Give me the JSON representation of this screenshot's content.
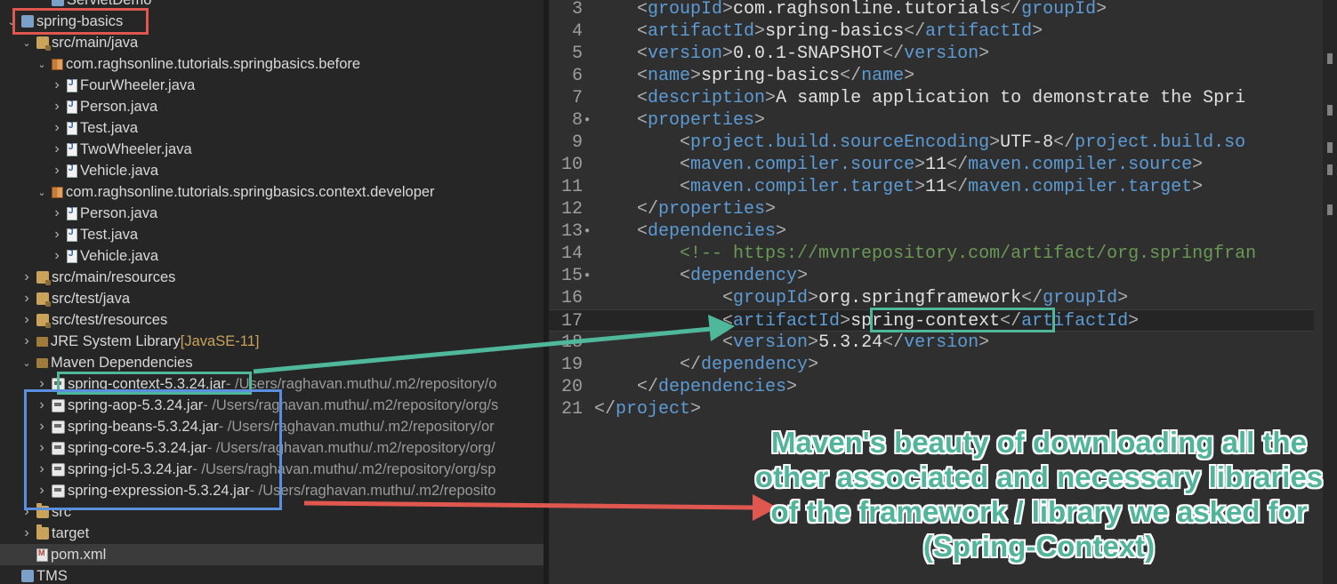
{
  "explorer": {
    "rows": [
      {
        "text": "ServletDemo",
        "suffix": "",
        "depth": 2,
        "twisty": "",
        "icon": "project"
      },
      {
        "text": "spring-basics",
        "suffix": "",
        "depth": 0,
        "twisty": "down",
        "icon": "project"
      },
      {
        "text": "src/main/java",
        "suffix": "",
        "depth": 1,
        "twisty": "down",
        "icon": "srcfolder"
      },
      {
        "text": "com.raghsonline.tutorials.springbasics.before",
        "suffix": "",
        "depth": 2,
        "twisty": "down",
        "icon": "package"
      },
      {
        "text": "FourWheeler.java",
        "suffix": "",
        "depth": 3,
        "twisty": "right",
        "icon": "java"
      },
      {
        "text": "Person.java",
        "suffix": "",
        "depth": 3,
        "twisty": "right",
        "icon": "java"
      },
      {
        "text": "Test.java",
        "suffix": "",
        "depth": 3,
        "twisty": "right",
        "icon": "java"
      },
      {
        "text": "TwoWheeler.java",
        "suffix": "",
        "depth": 3,
        "twisty": "right",
        "icon": "java"
      },
      {
        "text": "Vehicle.java",
        "suffix": "",
        "depth": 3,
        "twisty": "right",
        "icon": "java"
      },
      {
        "text": "com.raghsonline.tutorials.springbasics.context.developer",
        "suffix": "",
        "depth": 2,
        "twisty": "down",
        "icon": "package"
      },
      {
        "text": "Person.java",
        "suffix": "",
        "depth": 3,
        "twisty": "right",
        "icon": "java"
      },
      {
        "text": "Test.java",
        "suffix": "",
        "depth": 3,
        "twisty": "right",
        "icon": "java"
      },
      {
        "text": "Vehicle.java",
        "suffix": "",
        "depth": 3,
        "twisty": "right",
        "icon": "java"
      },
      {
        "text": "src/main/resources",
        "suffix": "",
        "depth": 1,
        "twisty": "right",
        "icon": "srcfolder"
      },
      {
        "text": "src/test/java",
        "suffix": "",
        "depth": 1,
        "twisty": "right",
        "icon": "srcfolder"
      },
      {
        "text": "src/test/resources",
        "suffix": "",
        "depth": 1,
        "twisty": "right",
        "icon": "srcfolder"
      },
      {
        "text": "JRE System Library",
        "suffix": " [JavaSE-11]",
        "suffix_style": "ann",
        "depth": 1,
        "twisty": "right",
        "icon": "lib"
      },
      {
        "text": "Maven Dependencies",
        "suffix": "",
        "depth": 1,
        "twisty": "down",
        "icon": "lib"
      },
      {
        "text": "spring-context-5.3.24.jar",
        "suffix": " - /Users/raghavan.muthu/.m2/repository/o",
        "depth": 2,
        "twisty": "right",
        "icon": "jar"
      },
      {
        "text": "spring-aop-5.3.24.jar",
        "suffix": " - /Users/raghavan.muthu/.m2/repository/org/s",
        "depth": 2,
        "twisty": "right",
        "icon": "jar"
      },
      {
        "text": "spring-beans-5.3.24.jar",
        "suffix": " - /Users/raghavan.muthu/.m2/repository/or",
        "depth": 2,
        "twisty": "right",
        "icon": "jar"
      },
      {
        "text": "spring-core-5.3.24.jar",
        "suffix": " - /Users/raghavan.muthu/.m2/repository/org/",
        "depth": 2,
        "twisty": "right",
        "icon": "jar"
      },
      {
        "text": "spring-jcl-5.3.24.jar",
        "suffix": " - /Users/raghavan.muthu/.m2/repository/org/sp",
        "depth": 2,
        "twisty": "right",
        "icon": "jar"
      },
      {
        "text": "spring-expression-5.3.24.jar",
        "suffix": " - /Users/raghavan.muthu/.m2/reposito",
        "depth": 2,
        "twisty": "right",
        "icon": "jar"
      },
      {
        "text": "src",
        "suffix": "",
        "depth": 1,
        "twisty": "right",
        "icon": "folder"
      },
      {
        "text": "target",
        "suffix": "",
        "depth": 1,
        "twisty": "right",
        "icon": "folder"
      },
      {
        "text": "pom.xml",
        "suffix": "",
        "depth": 1,
        "twisty": "",
        "icon": "xml"
      },
      {
        "text": "TMS",
        "suffix": "",
        "depth": 0,
        "twisty": "",
        "icon": "project"
      }
    ]
  },
  "editor": {
    "lines": [
      {
        "n": "3",
        "fold": false,
        "html": [
          [
            "b",
            "    <"
          ],
          [
            "t",
            "groupId"
          ],
          [
            "b",
            ">"
          ],
          [
            "v",
            "com.raghsonline.tutorials"
          ],
          [
            "b",
            "</"
          ],
          [
            "t",
            "groupId"
          ],
          [
            "b",
            ">"
          ]
        ]
      },
      {
        "n": "4",
        "fold": false,
        "html": [
          [
            "b",
            "    <"
          ],
          [
            "t",
            "artifactId"
          ],
          [
            "b",
            ">"
          ],
          [
            "v",
            "spring-basics"
          ],
          [
            "b",
            "</"
          ],
          [
            "t",
            "artifactId"
          ],
          [
            "b",
            ">"
          ]
        ]
      },
      {
        "n": "5",
        "fold": false,
        "html": [
          [
            "b",
            "    <"
          ],
          [
            "t",
            "version"
          ],
          [
            "b",
            ">"
          ],
          [
            "v",
            "0.0.1-SNAPSHOT"
          ],
          [
            "b",
            "</"
          ],
          [
            "t",
            "version"
          ],
          [
            "b",
            ">"
          ]
        ]
      },
      {
        "n": "6",
        "fold": false,
        "html": [
          [
            "b",
            "    <"
          ],
          [
            "t",
            "name"
          ],
          [
            "b",
            ">"
          ],
          [
            "v",
            "spring-basics"
          ],
          [
            "b",
            "</"
          ],
          [
            "t",
            "name"
          ],
          [
            "b",
            ">"
          ]
        ]
      },
      {
        "n": "7",
        "fold": false,
        "html": [
          [
            "b",
            "    <"
          ],
          [
            "t",
            "description"
          ],
          [
            "b",
            ">"
          ],
          [
            "v",
            "A sample application to demonstrate the Spri"
          ]
        ]
      },
      {
        "n": "8",
        "fold": true,
        "html": [
          [
            "b",
            "    <"
          ],
          [
            "t",
            "properties"
          ],
          [
            "b",
            ">"
          ]
        ]
      },
      {
        "n": "9",
        "fold": false,
        "html": [
          [
            "b",
            "        <"
          ],
          [
            "t",
            "project.build.sourceEncoding"
          ],
          [
            "b",
            ">"
          ],
          [
            "v",
            "UTF-8"
          ],
          [
            "b",
            "</"
          ],
          [
            "t",
            "project.build.so"
          ]
        ]
      },
      {
        "n": "10",
        "fold": false,
        "html": [
          [
            "b",
            "        <"
          ],
          [
            "t",
            "maven.compiler.source"
          ],
          [
            "b",
            ">"
          ],
          [
            "v",
            "11"
          ],
          [
            "b",
            "</"
          ],
          [
            "t",
            "maven.compiler.source"
          ],
          [
            "b",
            ">"
          ]
        ]
      },
      {
        "n": "11",
        "fold": false,
        "html": [
          [
            "b",
            "        <"
          ],
          [
            "t",
            "maven.compiler.target"
          ],
          [
            "b",
            ">"
          ],
          [
            "v",
            "11"
          ],
          [
            "b",
            "</"
          ],
          [
            "t",
            "maven.compiler.target"
          ],
          [
            "b",
            ">"
          ]
        ]
      },
      {
        "n": "12",
        "fold": false,
        "html": [
          [
            "b",
            "    </"
          ],
          [
            "t",
            "properties"
          ],
          [
            "b",
            ">"
          ]
        ]
      },
      {
        "n": "13",
        "fold": true,
        "html": [
          [
            "b",
            "    <"
          ],
          [
            "t",
            "dependencies"
          ],
          [
            "b",
            ">"
          ]
        ]
      },
      {
        "n": "14",
        "fold": false,
        "html": [
          [
            "c",
            "        <!-- https://mvnrepository.com/artifact/org.springfran"
          ]
        ]
      },
      {
        "n": "15",
        "fold": true,
        "html": [
          [
            "b",
            "        <"
          ],
          [
            "t",
            "dependency"
          ],
          [
            "b",
            ">"
          ]
        ]
      },
      {
        "n": "16",
        "fold": false,
        "html": [
          [
            "b",
            "            <"
          ],
          [
            "t",
            "groupId"
          ],
          [
            "b",
            ">"
          ],
          [
            "v",
            "org.springframework"
          ],
          [
            "b",
            "</"
          ],
          [
            "t",
            "groupId"
          ],
          [
            "b",
            ">"
          ]
        ]
      },
      {
        "n": "17",
        "fold": false,
        "current": true,
        "html": [
          [
            "b",
            "            <"
          ],
          [
            "t",
            "artifactId"
          ],
          [
            "b",
            ">"
          ],
          [
            "v",
            "spring-context"
          ],
          [
            "b",
            "</"
          ],
          [
            "t",
            "artifactId"
          ],
          [
            "b",
            ">"
          ]
        ]
      },
      {
        "n": "18",
        "fold": false,
        "html": [
          [
            "b",
            "            <"
          ],
          [
            "t",
            "version"
          ],
          [
            "b",
            ">"
          ],
          [
            "v",
            "5.3.24"
          ],
          [
            "b",
            "</"
          ],
          [
            "t",
            "version"
          ],
          [
            "b",
            ">"
          ]
        ]
      },
      {
        "n": "19",
        "fold": false,
        "html": [
          [
            "b",
            "        </"
          ],
          [
            "t",
            "dependency"
          ],
          [
            "b",
            ">"
          ]
        ]
      },
      {
        "n": "20",
        "fold": false,
        "html": [
          [
            "b",
            "    </"
          ],
          [
            "t",
            "dependencies"
          ],
          [
            "b",
            ">"
          ]
        ]
      },
      {
        "n": "21",
        "fold": false,
        "html": [
          [
            "b",
            "</"
          ],
          [
            "t",
            "project"
          ],
          [
            "b",
            ">"
          ]
        ]
      }
    ]
  },
  "callout": {
    "text": "Maven's beauty of downloading all the other associated and necessary libraries of the framework / library we asked for (Spring-Context)"
  },
  "colors": {
    "project_highlight": "#e0574f",
    "context_highlight": "#4fb89a",
    "deps_highlight": "#5b8fe0",
    "arrow_red": "#e0574f",
    "arrow_green": "#4fb89a"
  }
}
